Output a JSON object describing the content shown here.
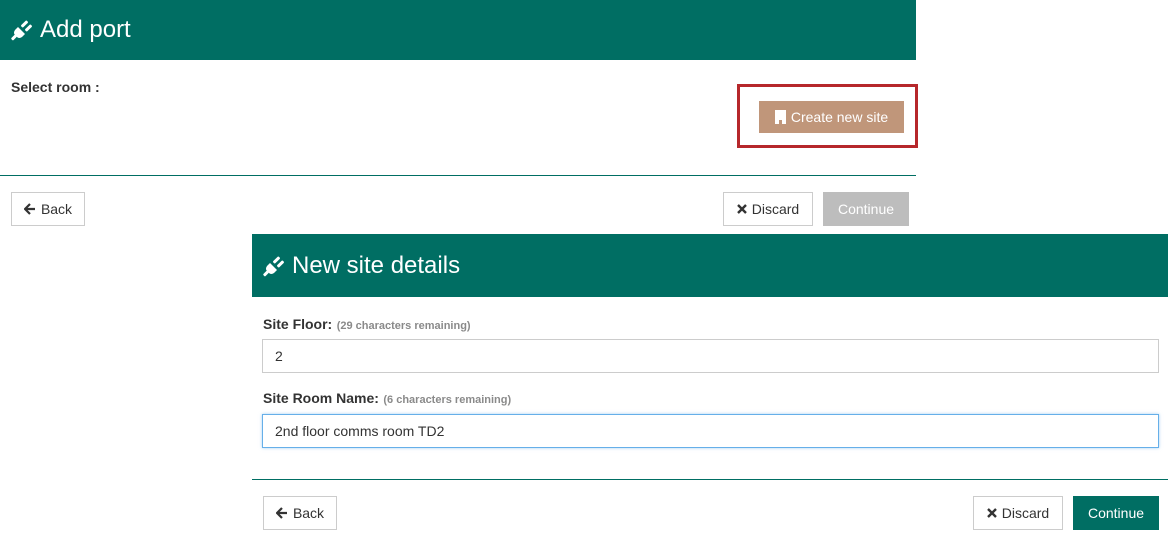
{
  "add_port": {
    "title": "Add port",
    "select_room_label": "Select room :",
    "create_site_button": "Create new site",
    "back_button": "Back",
    "discard_button": "Discard",
    "continue_button": "Continue"
  },
  "new_site": {
    "title": "New site details",
    "site_floor_label": "Site Floor:",
    "site_floor_hint": "(29 characters remaining)",
    "site_floor_value": "2",
    "site_room_label": "Site Room Name:",
    "site_room_hint": "(6 characters remaining)",
    "site_room_value": "2nd floor comms room TD2",
    "back_button": "Back",
    "discard_button": "Discard",
    "continue_button": "Continue"
  },
  "colors": {
    "header_teal": "#006e63",
    "create_site_tan": "#c0967a",
    "highlight_red": "#b6282b",
    "disabled_grey": "#bdbdbd"
  },
  "icons": {
    "header": "plug-icon",
    "create_site": "document-icon",
    "back": "arrow-left-icon",
    "discard": "times-icon"
  }
}
